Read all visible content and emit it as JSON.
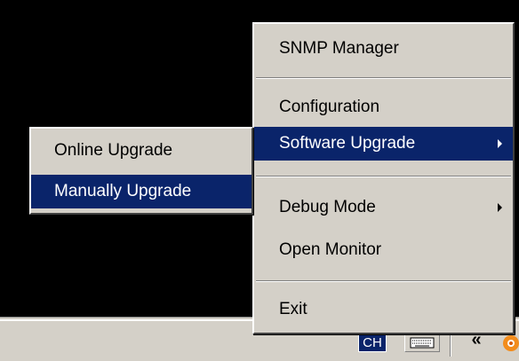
{
  "context_menu": {
    "items": [
      {
        "label": "SNMP Manager"
      },
      {
        "label": "Configuration"
      },
      {
        "label": "Software Upgrade",
        "has_submenu": true,
        "highlighted": true
      },
      {
        "label": "Debug Mode",
        "has_submenu": true
      },
      {
        "label": "Open Monitor"
      },
      {
        "label": "Exit"
      }
    ]
  },
  "submenu": {
    "items": [
      {
        "label": "Online Upgrade"
      },
      {
        "label": "Manually Upgrade",
        "highlighted": true
      }
    ]
  },
  "tray": {
    "language_indicator": "CH",
    "overflow_chevron": "«",
    "icons": [
      "keyboard-icon",
      "app-tray-icon"
    ]
  },
  "colors": {
    "menu_bg": "#d4d0c8",
    "highlight_bg": "#0a246a",
    "highlight_text": "#ffffff",
    "desktop": "#000000"
  }
}
